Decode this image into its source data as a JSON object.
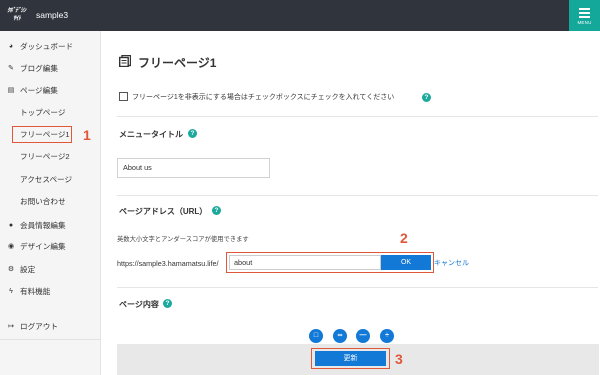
{
  "header": {
    "site_name": "sample3",
    "menu_label": "MENU",
    "logo_text_1": "ｸﾎﾞﾃﾞｼﾝ",
    "logo_text_2": "ｻｲﾄ"
  },
  "sidebar": {
    "items": [
      {
        "label": "ダッシュボード",
        "icon": "gauge-icon"
      },
      {
        "label": "ブログ編集",
        "icon": "pencil-icon"
      },
      {
        "label": "ページ編集",
        "icon": "pages-icon"
      },
      {
        "label": "トップページ"
      },
      {
        "label": "フリーページ1"
      },
      {
        "label": "フリーページ2"
      },
      {
        "label": "アクセスページ"
      },
      {
        "label": "お問い合わせ"
      },
      {
        "label": "会員情報編集",
        "icon": "user-icon"
      },
      {
        "label": "デザイン編集",
        "icon": "palette-icon"
      },
      {
        "label": "設定",
        "icon": "gear-icon"
      },
      {
        "label": "有料機能",
        "icon": "bolt-icon"
      },
      {
        "label": "ログアウト",
        "icon": "logout-icon"
      }
    ]
  },
  "annotations": {
    "n1": "1",
    "n2": "2",
    "n3": "3"
  },
  "main": {
    "title": "フリーページ1",
    "hide_checkbox_label": "フリーページ1を非表示にする場合はチェックボックスにチェックを入れてください",
    "menu_title_heading": "メニュータイトル",
    "menu_title_value": "About us",
    "page_address_heading": "ページアドレス（URL）",
    "address_note": "英数大小文字とアンダースコアが使用できます",
    "url_prefix": "https://sample3.hamamatsu.life/",
    "url_value": "about",
    "ok_label": "OK",
    "cancel_label": "キャンセル",
    "content_heading": "ページ内容",
    "help_glyph": "?",
    "tools": [
      {
        "name": "square-tool-icon",
        "glyph": "□"
      },
      {
        "name": "link-tool-icon",
        "glyph": "∞"
      },
      {
        "name": "minus-tool-icon",
        "glyph": "—"
      },
      {
        "name": "divide-tool-icon",
        "glyph": "÷"
      }
    ],
    "update_label": "更新"
  },
  "colors": {
    "topbar": "#30343d",
    "accent": "#14a89a",
    "primary": "#1279d6",
    "annotation": "#e0573a"
  }
}
